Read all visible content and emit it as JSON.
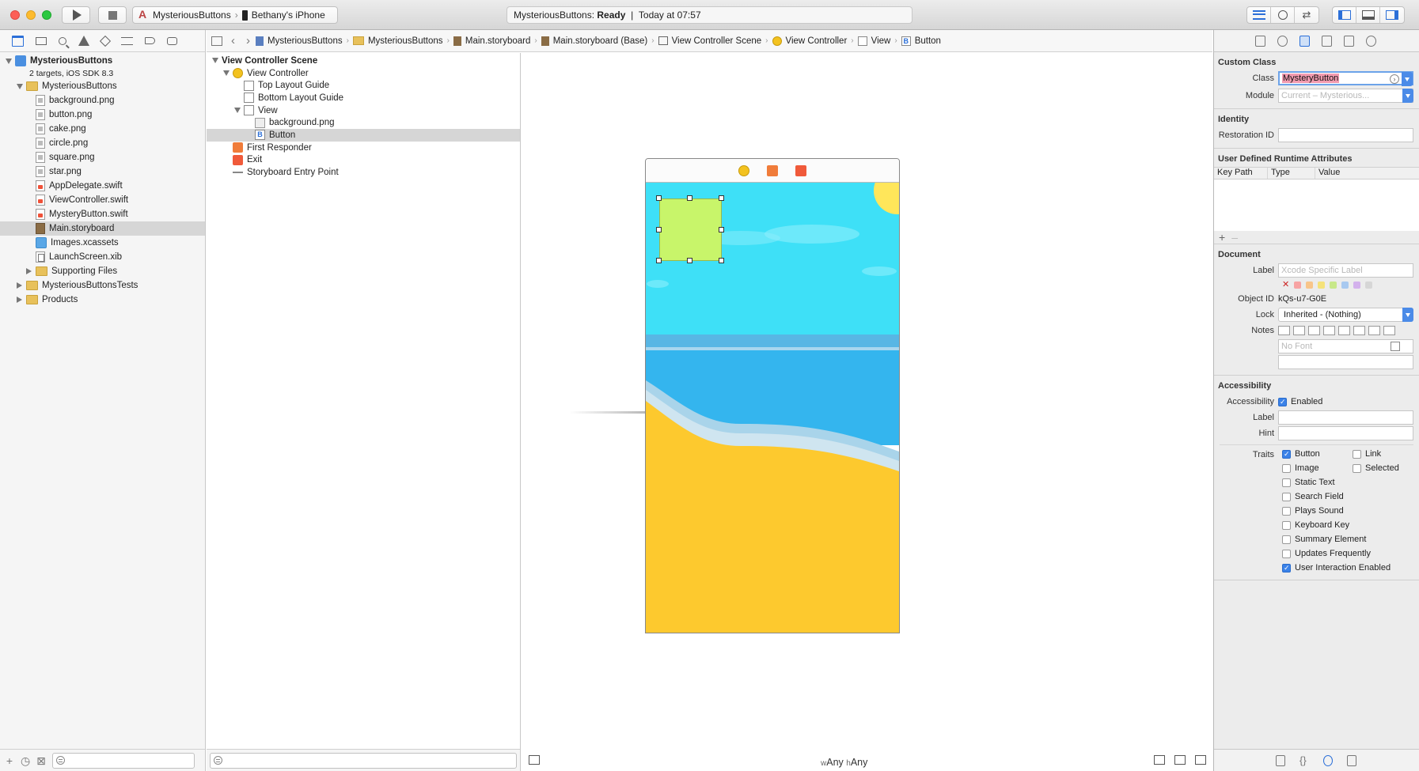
{
  "toolbar": {
    "scheme": "MysteriousButtons",
    "device": "Bethany's iPhone",
    "status_app": "MysteriousButtons:",
    "status_state": "Ready",
    "status_sep": "|",
    "status_time": "Today at 07:57"
  },
  "navigator": {
    "project": {
      "name": "MysteriousButtons",
      "subtitle": "2 targets, iOS SDK 8.3"
    },
    "items": [
      {
        "label": "MysteriousButtons",
        "type": "folder",
        "depth": 1,
        "disclosure": "open"
      },
      {
        "label": "background.png",
        "type": "png",
        "depth": 2
      },
      {
        "label": "button.png",
        "type": "png",
        "depth": 2
      },
      {
        "label": "cake.png",
        "type": "png",
        "depth": 2
      },
      {
        "label": "circle.png",
        "type": "png",
        "depth": 2
      },
      {
        "label": "square.png",
        "type": "png",
        "depth": 2
      },
      {
        "label": "star.png",
        "type": "png",
        "depth": 2
      },
      {
        "label": "AppDelegate.swift",
        "type": "swift",
        "depth": 2
      },
      {
        "label": "ViewController.swift",
        "type": "swift",
        "depth": 2
      },
      {
        "label": "MysteryButton.swift",
        "type": "swift",
        "depth": 2
      },
      {
        "label": "Main.storyboard",
        "type": "storyboard",
        "depth": 2,
        "selected": true
      },
      {
        "label": "Images.xcassets",
        "type": "xcassets",
        "depth": 2
      },
      {
        "label": "LaunchScreen.xib",
        "type": "xib",
        "depth": 2
      },
      {
        "label": "Supporting Files",
        "type": "folder",
        "depth": 2,
        "disclosure": "closed"
      },
      {
        "label": "MysteriousButtonsTests",
        "type": "folder",
        "depth": 1,
        "disclosure": "closed"
      },
      {
        "label": "Products",
        "type": "folder",
        "depth": 1,
        "disclosure": "closed"
      }
    ]
  },
  "jumpbar": {
    "items": [
      {
        "label": "MysteriousButtons",
        "icon": "doc"
      },
      {
        "label": "MysteriousButtons",
        "icon": "folder"
      },
      {
        "label": "Main.storyboard",
        "icon": "sb"
      },
      {
        "label": "Main.storyboard (Base)",
        "icon": "sb"
      },
      {
        "label": "View Controller Scene",
        "icon": "scene"
      },
      {
        "label": "View Controller",
        "icon": "vc"
      },
      {
        "label": "View",
        "icon": "view"
      },
      {
        "label": "Button",
        "icon": "b"
      }
    ]
  },
  "outline": {
    "items": [
      {
        "label": "View Controller Scene",
        "icon": "none",
        "depth": 0,
        "disclosure": "open",
        "bold": true
      },
      {
        "label": "View Controller",
        "icon": "vc",
        "depth": 1,
        "disclosure": "open"
      },
      {
        "label": "Top Layout Guide",
        "icon": "guide",
        "depth": 2
      },
      {
        "label": "Bottom Layout Guide",
        "icon": "guide",
        "depth": 2
      },
      {
        "label": "View",
        "icon": "view",
        "depth": 2,
        "disclosure": "open"
      },
      {
        "label": "background.png",
        "icon": "img",
        "depth": 3
      },
      {
        "label": "Button",
        "icon": "btn",
        "depth": 3,
        "selected": true
      },
      {
        "label": "First Responder",
        "icon": "resp",
        "depth": 1
      },
      {
        "label": "Exit",
        "icon": "exit",
        "depth": 1
      },
      {
        "label": "Storyboard Entry Point",
        "icon": "arrow",
        "depth": 1
      }
    ],
    "button_glyph": "B"
  },
  "canvas": {
    "size_w_prefix": "w",
    "size_w": "Any",
    "size_h_prefix": "h",
    "size_h": "Any"
  },
  "inspector": {
    "custom_class": {
      "title": "Custom Class",
      "class_label": "Class",
      "class_value": "MysteryButton",
      "module_label": "Module",
      "module_placeholder": "Current – Mysterious..."
    },
    "identity": {
      "title": "Identity",
      "restoration_label": "Restoration ID",
      "restoration_value": ""
    },
    "udra": {
      "title": "User Defined Runtime Attributes",
      "col_keypath": "Key Path",
      "col_type": "Type",
      "col_value": "Value",
      "add": "+",
      "remove": "–"
    },
    "document": {
      "title": "Document",
      "label_label": "Label",
      "label_placeholder": "Xcode Specific Label",
      "swatch_colors": [
        "#f7a3a3",
        "#f8c58a",
        "#f5e27a",
        "#c8e88a",
        "#a8c9f0",
        "#d3b1ec",
        "#d6d6d6"
      ],
      "object_id_label": "Object ID",
      "object_id_value": "kQs-u7-G0E",
      "lock_label": "Lock",
      "lock_value": "Inherited - (Nothing)",
      "notes_label": "Notes",
      "font_placeholder": "No Font"
    },
    "accessibility": {
      "title": "Accessibility",
      "accessibility_label": "Accessibility",
      "enabled_label": "Enabled",
      "enabled_checked": true,
      "label_label": "Label",
      "hint_label": "Hint",
      "traits_label": "Traits",
      "traits": [
        {
          "label": "Button",
          "checked": true
        },
        {
          "label": "Link",
          "checked": false
        },
        {
          "label": "Image",
          "checked": false
        },
        {
          "label": "Selected",
          "checked": false
        },
        {
          "label": "Static Text",
          "checked": false
        },
        {
          "label": "Search Field",
          "checked": false
        },
        {
          "label": "Plays Sound",
          "checked": false
        },
        {
          "label": "Keyboard Key",
          "checked": false
        },
        {
          "label": "Summary Element",
          "checked": false
        },
        {
          "label": "Updates Frequently",
          "checked": false
        },
        {
          "label": "User Interaction Enabled",
          "checked": true
        }
      ]
    }
  }
}
